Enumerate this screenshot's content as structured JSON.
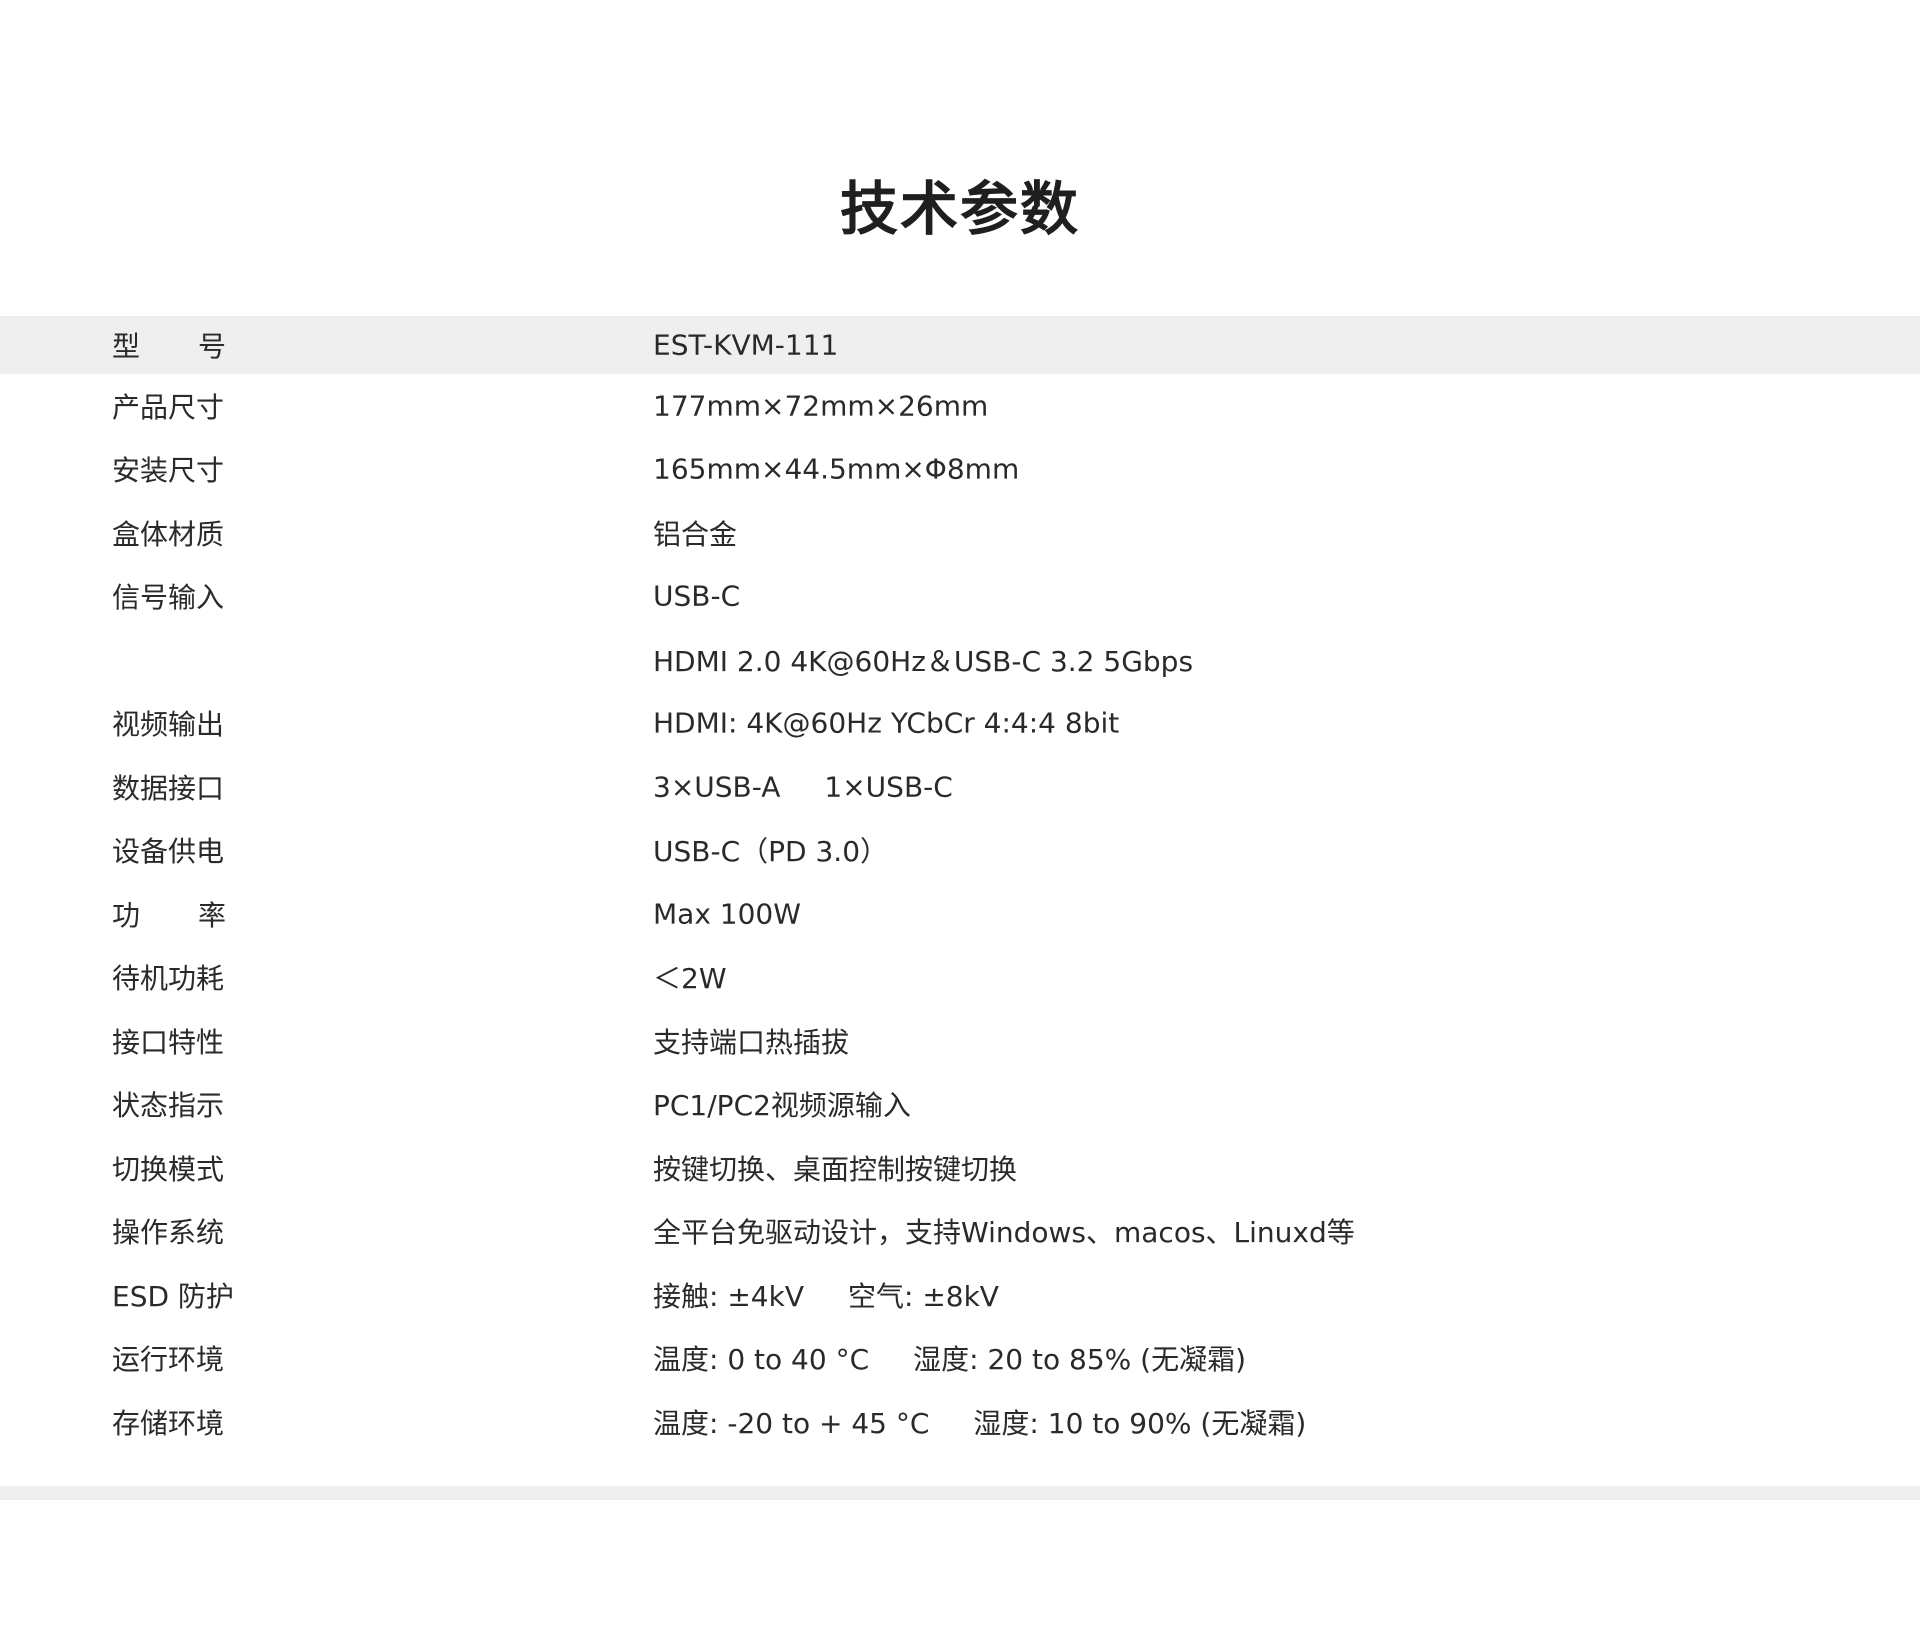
{
  "title": "技术参数",
  "specs": [
    {
      "label_a": "型",
      "label_b": "号",
      "value": "EST-KVM-111"
    },
    {
      "label": "产品尺寸",
      "value": "177mm×72mm×26mm"
    },
    {
      "label": "安装尺寸",
      "value": "165mm×44.5mm×Φ8mm"
    },
    {
      "label": "盒体材质",
      "value": "铝合金"
    },
    {
      "label": "信号输入",
      "value": "USB-C"
    },
    {
      "label": "",
      "value": "HDMI 2.0 4K@60Hz＆USB-C 3.2 5Gbps"
    },
    {
      "label": "视频输出",
      "value": "HDMI: 4K@60Hz YCbCr 4:4:4 8bit"
    },
    {
      "label": "数据接口",
      "value_a": "3×USB-A",
      "value_b": "1×USB-C"
    },
    {
      "label": "设备供电",
      "value": "USB-C（PD 3.0）"
    },
    {
      "label_a": "功",
      "label_b": "率",
      "value": "Max 100W"
    },
    {
      "label": "待机功耗",
      "value": "＜2W"
    },
    {
      "label": "接口特性",
      "value": "支持端口热插拔"
    },
    {
      "label": "状态指示",
      "value": "PC1/PC2视频源输入"
    },
    {
      "label": "切换模式",
      "value": "按键切换、桌面控制按键切换"
    },
    {
      "label": "操作系统",
      "value": "全平台免驱动设计，支持Windows、macos、Linuxd等"
    },
    {
      "label": "ESD 防护",
      "value_a": "接触: ±4kV",
      "value_b": "空气: ±8kV"
    },
    {
      "label": "运行环境",
      "value_a": "温度: 0 to 40 °C",
      "value_b": "湿度: 20 to 85% (无凝霜)"
    },
    {
      "label": "存储环境",
      "value_a": "温度: -20 to + 45 °C",
      "value_b": "湿度: 10 to 90% (无凝霜)"
    }
  ]
}
